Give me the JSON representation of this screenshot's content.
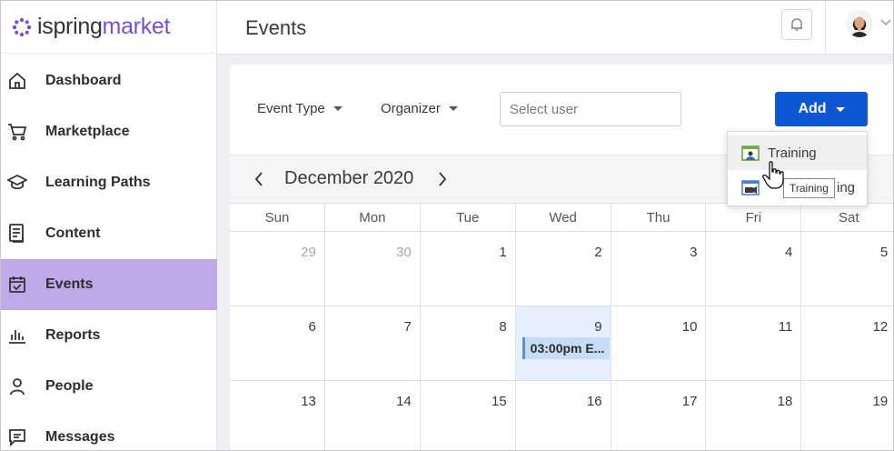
{
  "brand": {
    "name_part1": "ispring",
    "name_part2": "market"
  },
  "header": {
    "title": "Events"
  },
  "sidebar": {
    "items": [
      {
        "label": "Dashboard",
        "icon": "home-icon"
      },
      {
        "label": "Marketplace",
        "icon": "cart-icon"
      },
      {
        "label": "Learning Paths",
        "icon": "graduation-cap-icon"
      },
      {
        "label": "Content",
        "icon": "document-icon"
      },
      {
        "label": "Events",
        "icon": "calendar-check-icon",
        "active": true
      },
      {
        "label": "Reports",
        "icon": "bar-chart-icon"
      },
      {
        "label": "People",
        "icon": "person-icon"
      },
      {
        "label": "Messages",
        "icon": "message-icon"
      }
    ]
  },
  "toolbar": {
    "event_type": "Event Type",
    "organizer": "Organizer",
    "select_user_placeholder": "Select user",
    "add_label": "Add"
  },
  "calendar": {
    "month_label": "December 2020",
    "header_partial_text": "t",
    "weekdays": [
      "Sun",
      "Mon",
      "Tue",
      "Wed",
      "Thu",
      "Fri",
      "Sat"
    ],
    "weeks": [
      [
        {
          "d": "29",
          "muted": true
        },
        {
          "d": "30",
          "muted": true
        },
        {
          "d": "1"
        },
        {
          "d": "2"
        },
        {
          "d": "3"
        },
        {
          "d": "4"
        },
        {
          "d": "5"
        }
      ],
      [
        {
          "d": "6"
        },
        {
          "d": "7"
        },
        {
          "d": "8"
        },
        {
          "d": "9",
          "today": true,
          "event": "03:00pm E..."
        },
        {
          "d": "10"
        },
        {
          "d": "11"
        },
        {
          "d": "12"
        }
      ],
      [
        {
          "d": "13"
        },
        {
          "d": "14"
        },
        {
          "d": "15"
        },
        {
          "d": "16"
        },
        {
          "d": "17"
        },
        {
          "d": "18"
        },
        {
          "d": "19"
        }
      ]
    ]
  },
  "add_menu": {
    "items": [
      {
        "label": "Training",
        "icon": "classroom-training-icon"
      },
      {
        "label": "ing",
        "icon": "online-meeting-icon"
      }
    ],
    "tooltip": "Training"
  },
  "colors": {
    "accent": "#0e56d4",
    "active_nav": "#c1a9e8",
    "brand_purple": "#7b4ed1"
  }
}
